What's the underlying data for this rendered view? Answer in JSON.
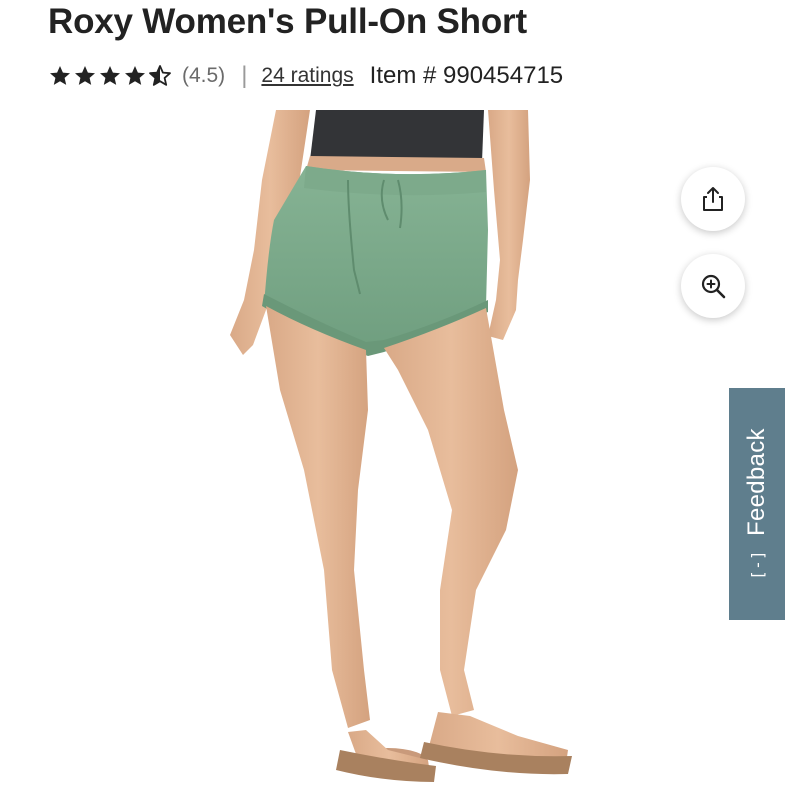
{
  "product": {
    "title": "Roxy Women's Pull-On Short",
    "rating_value": "(4.5)",
    "rating_numeric": 4.5,
    "ratings_link": "24 ratings",
    "item_number": "Item # 990454715"
  },
  "actions": {
    "share_icon": "share-icon",
    "zoom_icon": "zoom-in-icon"
  },
  "feedback": {
    "label": "Feedback",
    "icon": "[-]"
  },
  "colors": {
    "title": "#222222",
    "star": "#222222",
    "feedback_tab": "#5f7e8d",
    "shorts": "#7aa98a"
  }
}
